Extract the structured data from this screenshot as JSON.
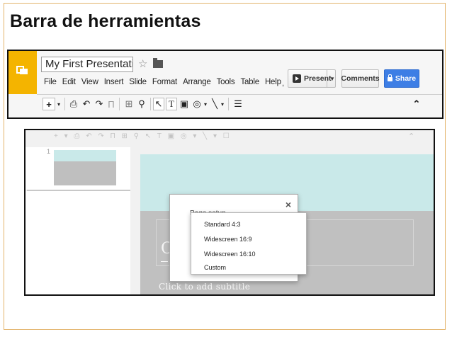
{
  "slide": {
    "title": "Barra de herramientas"
  },
  "toolbar_shot": {
    "doc_title": "My First Presentation",
    "menus": [
      "File",
      "Edit",
      "View",
      "Insert",
      "Slide",
      "Format",
      "Arrange",
      "Tools",
      "Table",
      "Help"
    ],
    "menu_extra": ",",
    "present_label": "Present",
    "comments_label": "Comments",
    "share_label": "Share",
    "colors": {
      "logo": "#f4b400",
      "share": "#3d7ee5"
    },
    "tools": {
      "add": "+",
      "add_drop": "▾",
      "print": "⎙",
      "undo": "↶",
      "redo": "↷",
      "paint": "Π",
      "zoom_fit": "⊞",
      "zoom": "⚲",
      "select": "↖",
      "text": "T",
      "image": "▣",
      "shape": "◎",
      "shape_drop": "▾",
      "line": "╲",
      "line_drop": "▾",
      "comment": "☰",
      "collapse": "⌃"
    }
  },
  "editor_shot": {
    "faded_tools": "+ ▾  ⎙ ↶ ↷ Π  ⊞ ⚲  ↖ T ▣ ◎ ▾ ╲ ▾  ☐",
    "faded_collapse": "⌃",
    "slide_number": "1",
    "title_glyph": "C",
    "subtitle_placeholder": "Click to add subtitle",
    "dialog": {
      "title": "Page setup",
      "close": "×",
      "options": [
        "Standard 4:3",
        "Widescreen 16:9",
        "Widescreen 16:10",
        "Custom"
      ]
    },
    "colors": {
      "canvas_top": "#c9e9e9",
      "canvas_bottom": "#c0c0c0"
    }
  }
}
